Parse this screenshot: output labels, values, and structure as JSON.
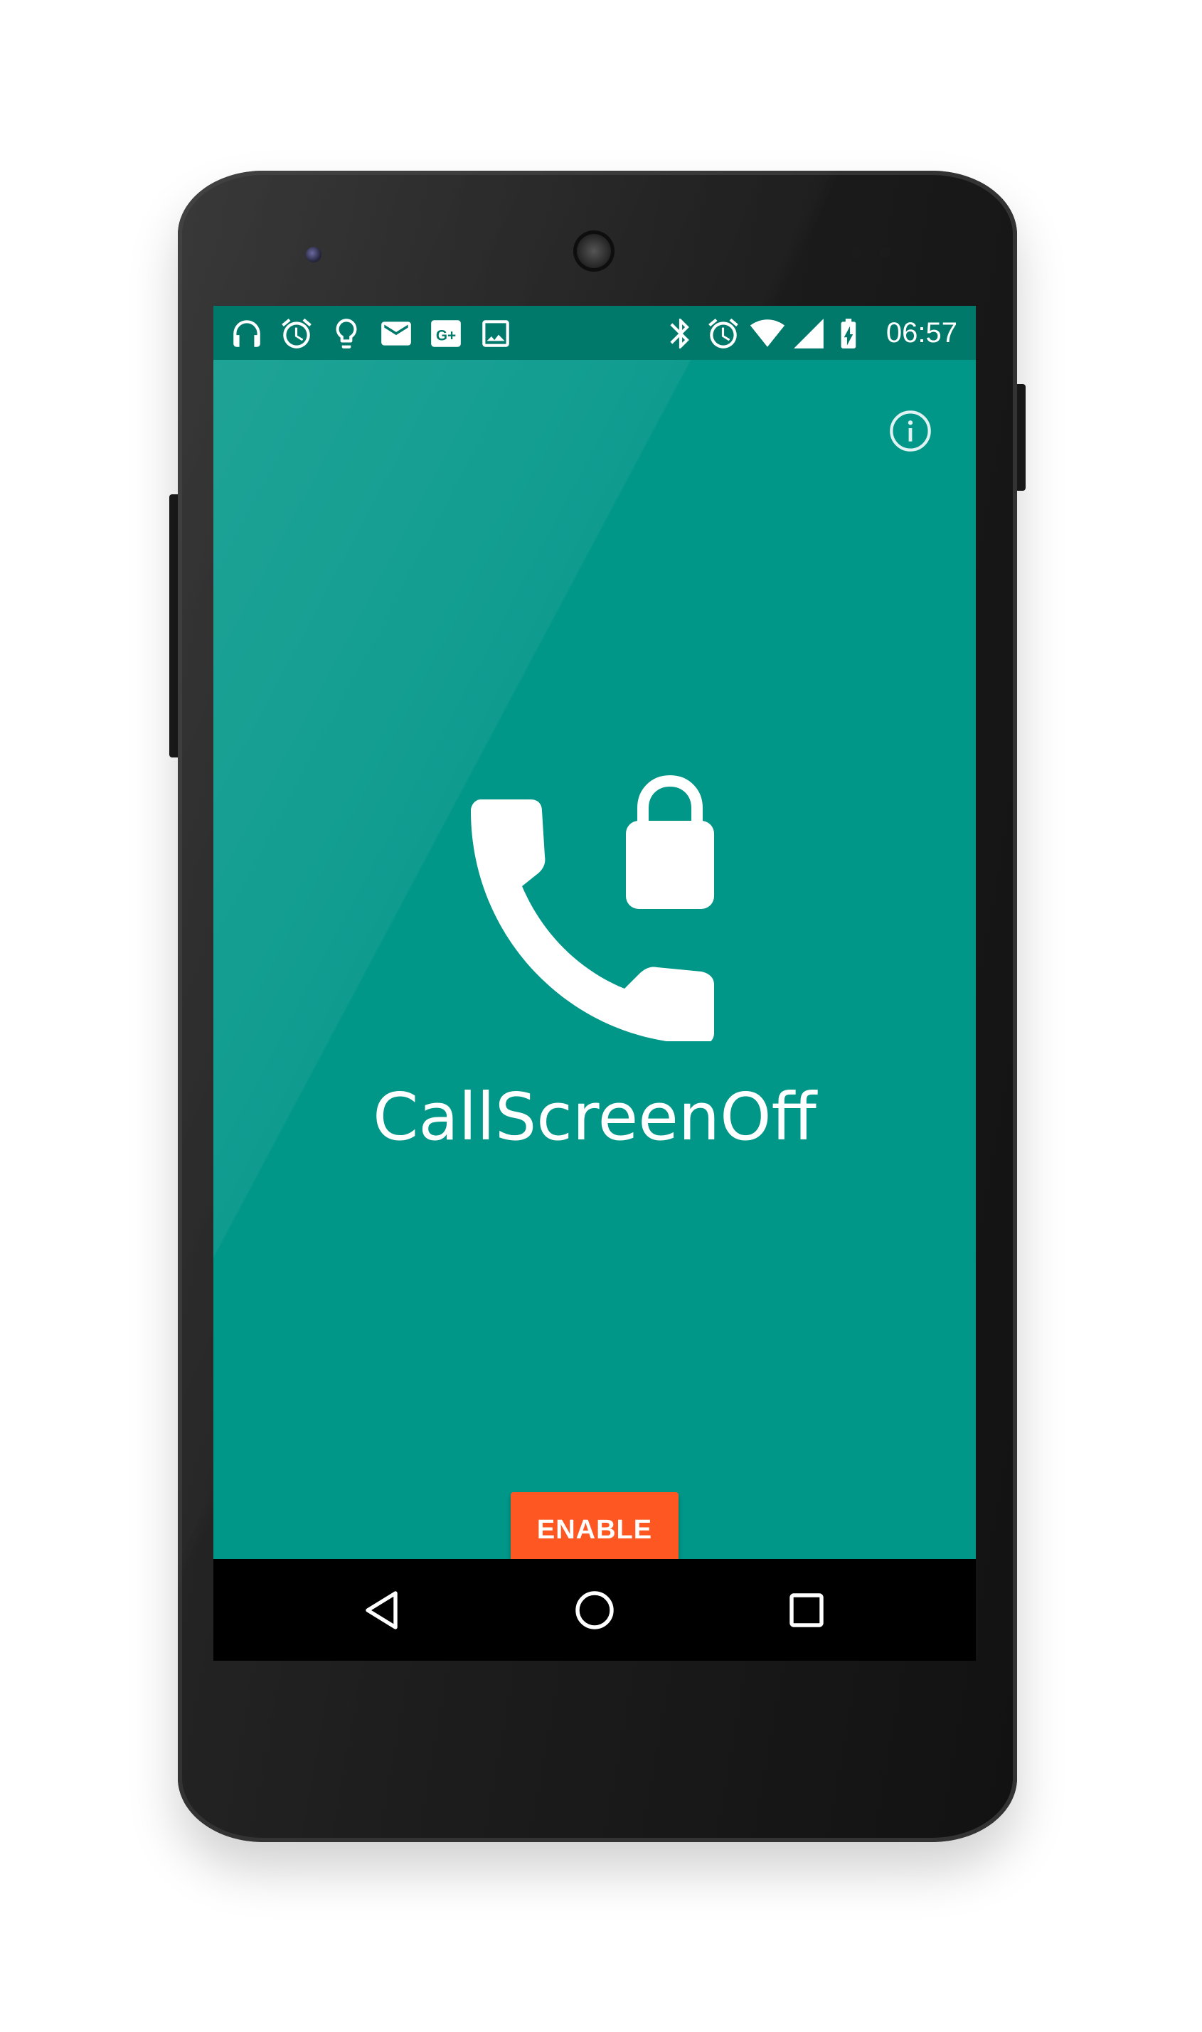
{
  "status_bar": {
    "left_icons": [
      "headphones-icon",
      "alarm-icon",
      "lightbulb-icon",
      "mail-icon",
      "google-plus-icon",
      "image-icon"
    ],
    "right_icons": [
      "bluetooth-icon",
      "alarm-icon",
      "wifi-icon",
      "signal-icon",
      "battery-charging-icon"
    ],
    "time": "06:57"
  },
  "app": {
    "title": "CallScreenOff",
    "background_color": "#009688",
    "status_bar_color": "#00796b",
    "logo_icon": "phone-lock-icon",
    "info_icon": "info-icon",
    "enable_button": {
      "label": "ENABLE",
      "color": "#ff5722"
    }
  },
  "nav_bar": {
    "buttons": [
      "back-icon",
      "home-icon",
      "recents-icon"
    ]
  }
}
